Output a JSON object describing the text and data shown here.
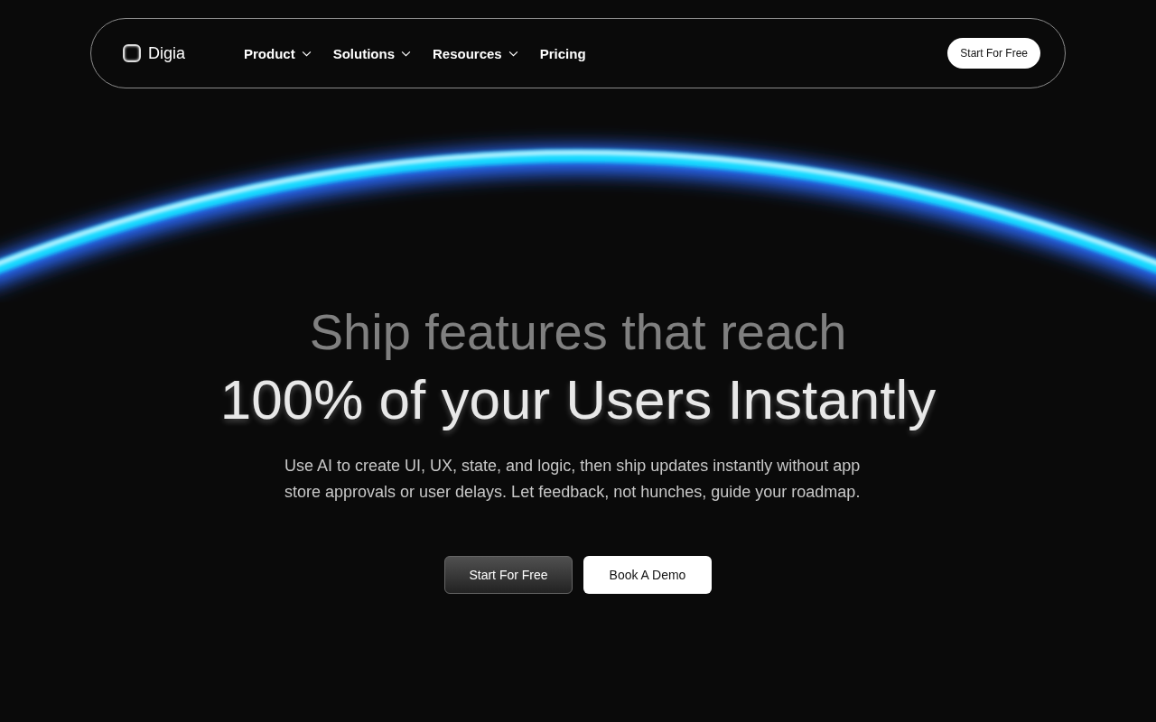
{
  "nav": {
    "brand": "Digia",
    "items": [
      {
        "label": "Product",
        "kind": "dropdown"
      },
      {
        "label": "Solutions",
        "kind": "dropdown"
      },
      {
        "label": "Resources",
        "kind": "dropdown"
      },
      {
        "label": "Pricing",
        "kind": "link"
      }
    ],
    "cta": "Start For Free"
  },
  "hero": {
    "headline_top": "Ship features that reach",
    "headline_main": "100% of your Users Instantly",
    "description": "Use AI to create UI, UX, state, and logic, then ship updates instantly without app store approvals or user delays. Let feedback, not hunches, guide your roadmap.",
    "buttons": [
      {
        "label": "Start For Free",
        "kind": "primary"
      },
      {
        "label": "Book A Demo",
        "kind": "secondary"
      }
    ]
  }
}
